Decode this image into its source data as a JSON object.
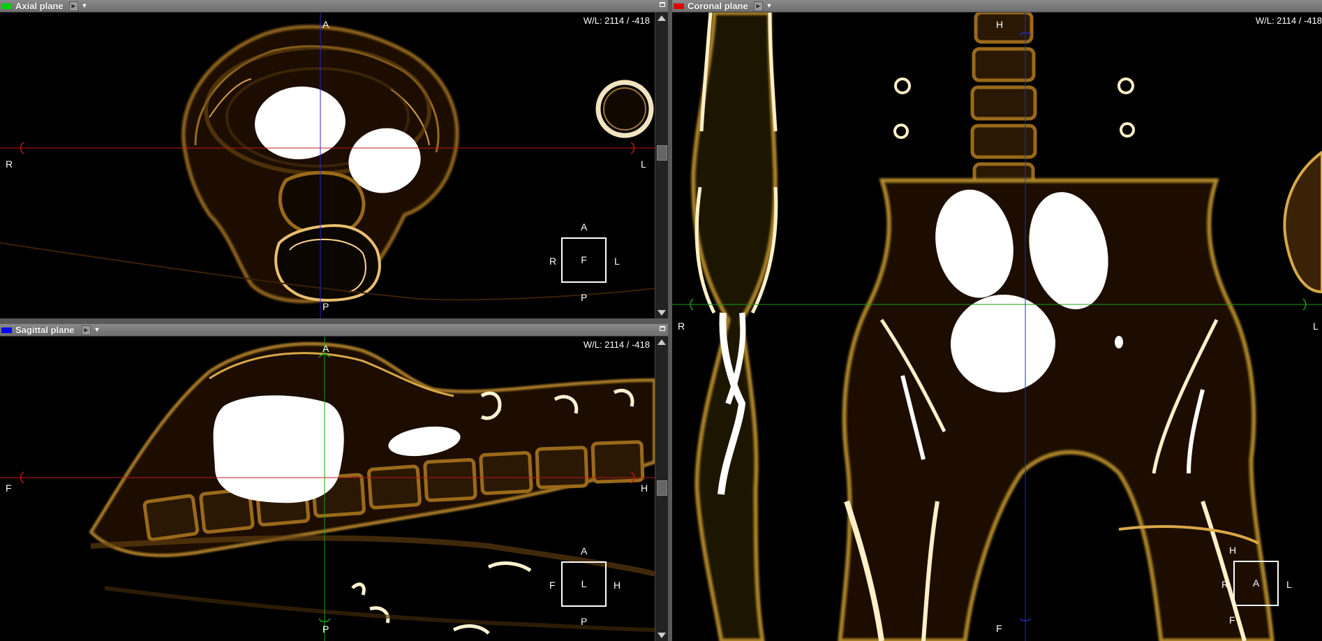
{
  "axial": {
    "title": "Axial plane",
    "swatch_color": "#00d000",
    "wl": "W/L: 2114 / -418",
    "labels": {
      "top": "A",
      "bottom": "P",
      "left": "R",
      "right": "L"
    },
    "cube": {
      "face": "F",
      "top": "A",
      "bottom": "P",
      "left": "R",
      "right": "L"
    }
  },
  "sagittal": {
    "title": "Sagittal plane",
    "swatch_color": "#0000ff",
    "wl": "W/L: 2114 / -418",
    "labels": {
      "top": "A",
      "bottom": "P",
      "left": "F",
      "right": "H"
    },
    "cube": {
      "face": "L",
      "top": "A",
      "bottom": "P",
      "left": "F",
      "right": "H"
    }
  },
  "coronal": {
    "title": "Coronal plane",
    "swatch_color": "#e00000",
    "wl": "W/L: 2114 / -418",
    "labels": {
      "top": "H",
      "bottom": "F",
      "left": "R",
      "right": "L"
    },
    "cube": {
      "face": "A",
      "top": "H",
      "bottom": "F",
      "left": "R",
      "right": "L"
    }
  },
  "icons": {
    "play": "play-triangle-icon",
    "menu": "dropdown-triangle-icon",
    "maximize": "maximize-window-icon"
  },
  "colors": {
    "crosshair_red": "#c01818",
    "crosshair_green": "#18a018",
    "crosshair_blue": "#2828c8",
    "bone": "#b58a2a",
    "titlebar": "#7c7c7c"
  }
}
